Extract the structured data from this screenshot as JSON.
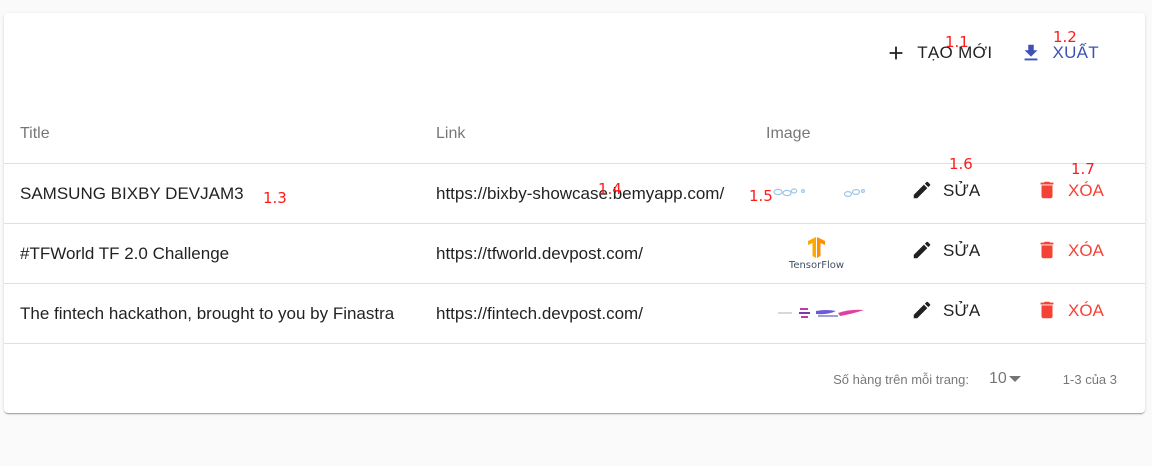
{
  "toolbar": {
    "create_label": "TẠO MỚI",
    "export_label": "XUẤT",
    "create_icon": "plus-icon",
    "export_icon": "download-icon"
  },
  "table": {
    "headers": [
      "Title",
      "Link",
      "Image",
      "",
      ""
    ],
    "rows": [
      {
        "title": "SAMSUNG BIXBY DEVJAM3",
        "link": "https://bixby-showcase.bemyapp.com/",
        "image": "bixby-thumbnail",
        "edit": "SỬA",
        "delete": "XÓA"
      },
      {
        "title": "#TFWorld TF 2.0 Challenge",
        "link": "https://tfworld.devpost.com/",
        "image": "tensorflow-logo",
        "image_text": "TensorFlow",
        "edit": "SỬA",
        "delete": "XÓA"
      },
      {
        "title": "The fintech hackathon, brought to you by Finastra",
        "link": "https://fintech.devpost.com/",
        "image": "fintech-thumbnail",
        "edit": "SỬA",
        "delete": "XÓA"
      }
    ]
  },
  "pagination": {
    "rows_per_page_label": "Số hàng trên mỗi trang:",
    "rows_per_page_value": "10",
    "range_label": "1-3 của 3"
  },
  "annotations": {
    "a11": "1.1",
    "a12": "1.2",
    "a13": "1.3",
    "a14": "1.4",
    "a15": "1.5",
    "a16": "1.6",
    "a17": "1.7"
  },
  "colors": {
    "primary": "#3f51b5",
    "danger": "#f44336",
    "annotation": "#ff1a1a",
    "tensorflow": "#ff8f00"
  }
}
